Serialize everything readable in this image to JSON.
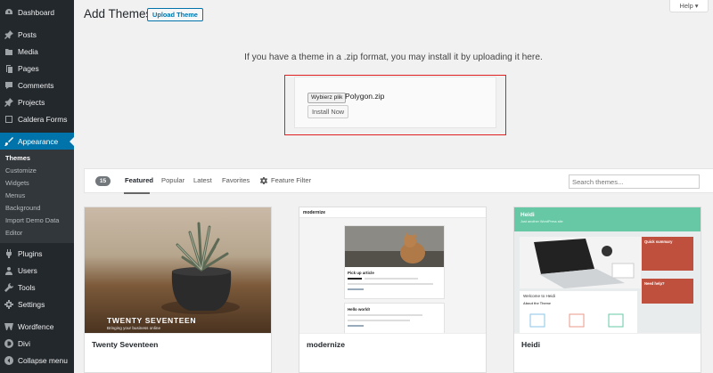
{
  "sidebar": {
    "top_items": [
      {
        "label": "Dashboard",
        "icon": "dashboard-icon"
      }
    ],
    "items": [
      {
        "label": "Posts",
        "icon": "pin-icon"
      },
      {
        "label": "Media",
        "icon": "media-icon"
      },
      {
        "label": "Pages",
        "icon": "pages-icon"
      },
      {
        "label": "Comments",
        "icon": "comments-icon"
      },
      {
        "label": "Projects",
        "icon": "pin-icon"
      },
      {
        "label": "Caldera Forms",
        "icon": "forms-icon"
      }
    ],
    "active_item": {
      "label": "Appearance",
      "icon": "brush-icon"
    },
    "submenu": [
      "Themes",
      "Customize",
      "Widgets",
      "Menus",
      "Background",
      "Import Demo Data",
      "Editor"
    ],
    "lower_items": [
      {
        "label": "Plugins",
        "icon": "plugin-icon"
      },
      {
        "label": "Users",
        "icon": "users-icon"
      },
      {
        "label": "Tools",
        "icon": "tools-icon"
      },
      {
        "label": "Settings",
        "icon": "settings-icon"
      }
    ],
    "bottom_items": [
      {
        "label": "Wordfence",
        "icon": "wordfence-icon"
      },
      {
        "label": "Divi",
        "icon": "divi-icon"
      },
      {
        "label": "Collapse menu",
        "icon": "collapse-icon"
      }
    ]
  },
  "header": {
    "title": "Add Themes",
    "upload_label": "Upload Theme",
    "help_label": "Help ▾"
  },
  "upload": {
    "description": "If you have a theme in a .zip format, you may install it by uploading it here.",
    "file_button": "Wybierz plik",
    "file_name": "Polygon.zip",
    "install_label": "Install Now"
  },
  "filter": {
    "count": "15",
    "tabs": [
      "Featured",
      "Popular",
      "Latest",
      "Favorites"
    ],
    "feature_filter": "Feature Filter",
    "search_placeholder": "Search themes..."
  },
  "themes": [
    {
      "name": "Twenty Seventeen",
      "shot_title": "TWENTY SEVENTEEN",
      "shot_sub": "Bringing your business online"
    },
    {
      "name": "modernize",
      "shot_logo": "modernize",
      "shot_post1": "Pick up article",
      "shot_post2": "Hello world!"
    },
    {
      "name": "Heidi",
      "shot_logo": "Heidi",
      "shot_tag": "Just another WordPress site",
      "shot_side1": "Quick summary",
      "shot_side2": "Need help?",
      "shot_welcome": "Welcome to Heidi",
      "shot_about": "About the Theme"
    }
  ],
  "colors": {
    "sidebar": "#23282d",
    "active": "#0073aa",
    "highlight": "#e02020",
    "heidi_green": "#67c8a6",
    "heidi_red": "#c0503e"
  }
}
